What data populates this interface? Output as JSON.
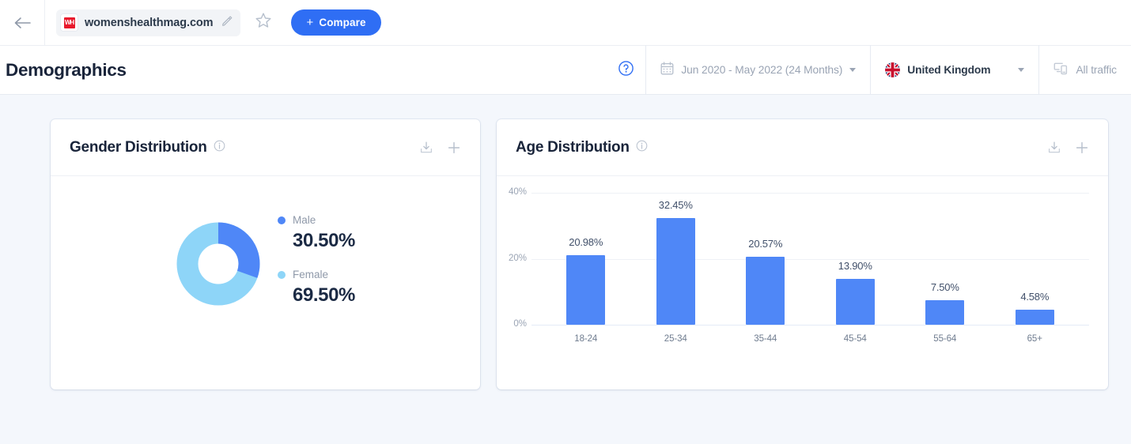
{
  "topbar": {
    "back_icon": "arrow-left-icon",
    "site_name": "womenshealthmag.com",
    "favicon_text": "WH",
    "edit_icon": "pencil-icon",
    "favorite_icon": "star-icon",
    "compare_plus": "+",
    "compare_label": "Compare"
  },
  "header": {
    "title": "Demographics",
    "help_icon": "question-circle-icon",
    "date_icon": "calendar-icon",
    "date_range": "Jun 2020 - May 2022 (24 Months)",
    "country_icon": "uk-flag-icon",
    "country": "United Kingdom",
    "traffic_icon": "devices-icon",
    "traffic": "All traffic"
  },
  "cards": {
    "gender": {
      "title": "Gender Distribution",
      "info_icon": "info-icon",
      "download_icon": "download-icon",
      "add_icon": "plus-icon"
    },
    "age": {
      "title": "Age Distribution",
      "info_icon": "info-icon",
      "download_icon": "download-icon",
      "add_icon": "plus-icon"
    }
  },
  "chart_data": [
    {
      "type": "pie",
      "title": "Gender Distribution",
      "variant": "donut",
      "legend_position": "right",
      "labels": [
        "Male",
        "Female"
      ],
      "values": [
        30.5,
        69.5
      ],
      "value_labels": [
        "30.50%",
        "69.50%"
      ],
      "colors": [
        "#4f87f7",
        "#8ed5f8"
      ]
    },
    {
      "type": "bar",
      "title": "Age Distribution",
      "categories": [
        "18-24",
        "25-34",
        "35-44",
        "45-54",
        "55-64",
        "65+"
      ],
      "values": [
        20.98,
        32.45,
        20.57,
        13.9,
        7.5,
        4.58
      ],
      "value_labels": [
        "20.98%",
        "32.45%",
        "20.57%",
        "13.90%",
        "7.50%",
        "4.58%"
      ],
      "ytick_labels": [
        "40%",
        "20%",
        "0%"
      ],
      "yticks": [
        40,
        20,
        0
      ],
      "ylim": [
        0,
        40
      ],
      "xlabel": "",
      "ylabel": "",
      "grid": true,
      "bar_color": "#4f87f7"
    }
  ]
}
